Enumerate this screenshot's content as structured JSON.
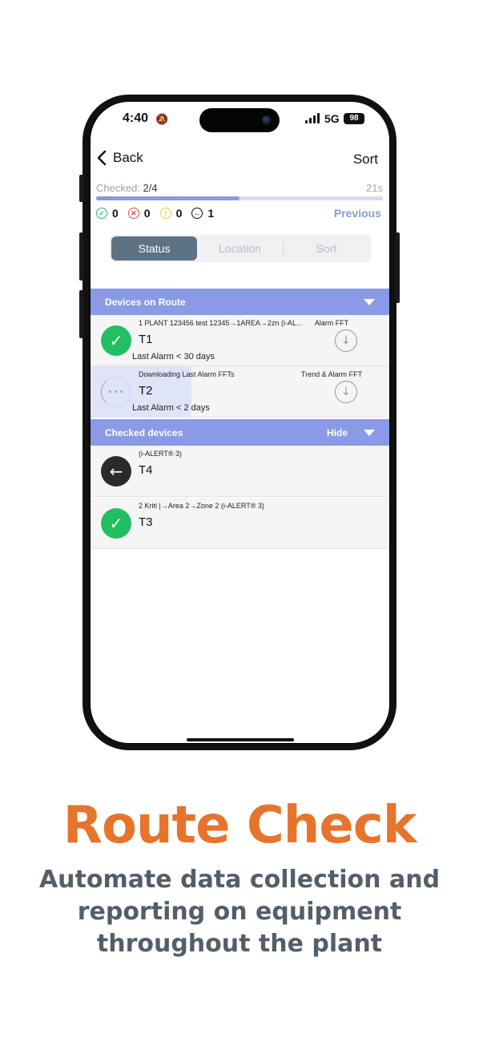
{
  "status_bar": {
    "time": "4:40",
    "network": "5G",
    "battery": "98"
  },
  "nav": {
    "back_label": "Back",
    "sort_label": "Sort"
  },
  "progress": {
    "checked_label": "Checked:",
    "checked_value": "2/4",
    "elapsed": "21s",
    "fraction": 0.5
  },
  "counts": {
    "ok": "0",
    "error": "0",
    "warning": "0",
    "skipped": "1",
    "previous_label": "Previous"
  },
  "tabs": [
    "Status",
    "Location",
    "Sort"
  ],
  "sections": {
    "route": {
      "title": "Devices on Route"
    },
    "checked": {
      "title": "Checked devices",
      "hide_label": "Hide"
    }
  },
  "route_devices": [
    {
      "path": "1 PLANT 123456 test 12345→1AREA→2zn (i-AL...",
      "name": "T1",
      "last_alarm": "Last Alarm < 30 days",
      "action": "Alarm FFT"
    },
    {
      "path": "Downloading Last Alarm FFTs",
      "name": "T2",
      "last_alarm": "Last Alarm < 2 days",
      "action": "Trend & Alarm FFT"
    }
  ],
  "checked_devices": [
    {
      "path": "(i-ALERT® 3)",
      "name": "T4"
    },
    {
      "path": "2 Kriti |→Area 2→Zone 2 (i-ALERT® 3)",
      "name": "T3"
    }
  ],
  "promo": {
    "headline": "Route Check",
    "subtitle_lines": [
      "Automate data collection and",
      "reporting on equipment",
      "throughout the plant"
    ]
  },
  "colors": {
    "accent": "#8b9ae6",
    "ok": "#22bf62",
    "error": "#e04848",
    "warning": "#f0c93a",
    "headline": "#e6742d",
    "subtitle": "#545e69"
  }
}
